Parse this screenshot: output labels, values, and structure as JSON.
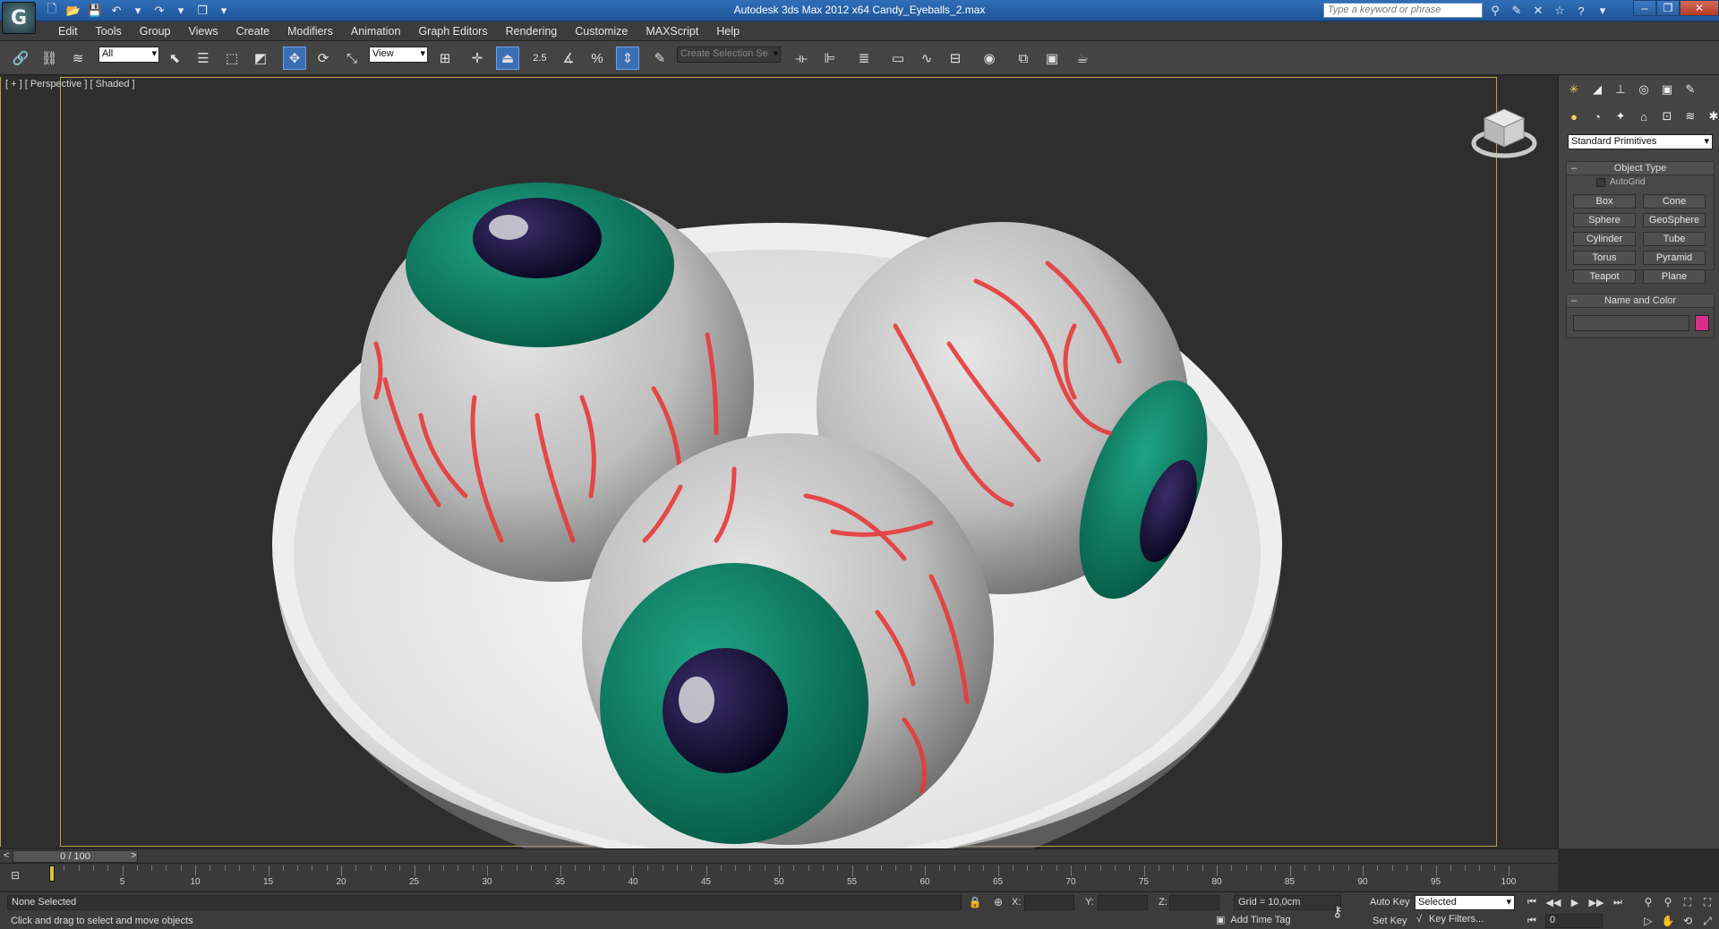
{
  "app": {
    "title": "Autodesk 3ds Max  2012 x64     Candy_Eyeballs_2.max",
    "logo_glyph": "G",
    "search_placeholder": "Type a keyword or phrase"
  },
  "menu": [
    "Edit",
    "Tools",
    "Group",
    "Views",
    "Create",
    "Modifiers",
    "Animation",
    "Graph Editors",
    "Rendering",
    "Customize",
    "MAXScript",
    "Help"
  ],
  "toolbar": {
    "selection_filter": "All",
    "ref_coord": "View",
    "snap_value": "2.5",
    "named_selection_placeholder": "Create Selection Se"
  },
  "viewport": {
    "label": "[ + ] [ Perspective ] [ Shaded ]",
    "background_color": "#2e2e2e",
    "frame_color": "#b8a24a",
    "scene_description_icons": [
      "bowl",
      "eyeball",
      "eyeball",
      "eyeball"
    ],
    "iris_color": "#0a7a60",
    "vein_color": "#e83a3a"
  },
  "command_panel": {
    "category": "Standard Primitives",
    "rollout_object_type": "Object Type",
    "autogrid_label": "AutoGrid",
    "buttons": [
      "Box",
      "Cone",
      "Sphere",
      "GeoSphere",
      "Cylinder",
      "Tube",
      "Torus",
      "Pyramid",
      "Teapot",
      "Plane"
    ],
    "rollout_name_color": "Name and Color",
    "swatch_color": "#d62e8a"
  },
  "timeline": {
    "position": "0 / 100",
    "prev": "<",
    "next": ">",
    "ticks": [
      5,
      10,
      15,
      20,
      25,
      30,
      35,
      40,
      45,
      50,
      55,
      60,
      65,
      70,
      75,
      80,
      85,
      90,
      95,
      100
    ]
  },
  "status": {
    "selection": "None Selected",
    "prompt": "Click and drag to select and move objects",
    "x_label": "X:",
    "y_label": "Y:",
    "z_label": "Z:",
    "grid": "Grid = 10,0cm",
    "add_time_tag": "Add Time Tag",
    "auto_key": "Auto Key",
    "set_key": "Set Key",
    "key_mode": "Selected",
    "key_filters": "Key Filters...",
    "frame": "0"
  }
}
